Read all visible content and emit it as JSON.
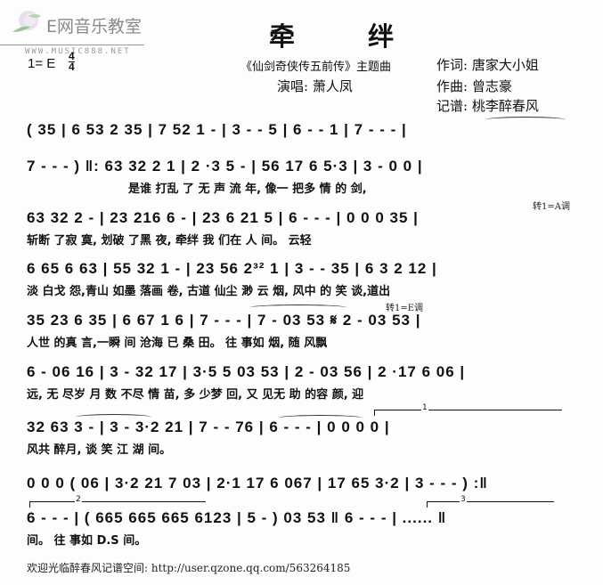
{
  "header": {
    "logo_text": "E网音乐教室",
    "logo_url_text": "WWW.MUSIC888.NET",
    "key": "1= E",
    "time_signature": {
      "top": "4",
      "bottom": "4"
    },
    "title": "牵 绊",
    "subtitle": "《仙剑奇侠传五前传》主题曲",
    "singer": "演唱: 萧人凤",
    "lyricist": "作词: 唐家大小姐",
    "composer": "作曲: 曾志豪",
    "transcriber": "记谱: 桃李醉春风"
  },
  "score": {
    "lines": [
      {
        "notes": "( 35 | 6 53 2 35 | 7 52 1 - | 3 - - 5 | 6 - - 1 | 7 - - - |",
        "lyrics": ""
      },
      {
        "notes": "7 - - - ) ‖: 63 32 2 1 | 2 ·3 5 - | 56 17 6 5·3 | 3 - 0 0 |",
        "lyrics": "是谁 打乱 了 无 声 流 年, 像一 把多 情 的 剑,"
      },
      {
        "notes": "63 32 2 - | 23 216 6 - | 23 6 21 5 | 6 - - - | 0 0 0 35 |",
        "lyrics": "斩断 了寂 寞, 划破 了黑 夜, 牵绊 我 们在 人 间。 云轻",
        "annotation": "转1=A调"
      },
      {
        "notes": "6 65 6 63 | 55 32 1 - | 23 56 2³² 1 | 3 - - 35 | 6 3 2 12 |",
        "lyrics": "淡 白戈 怨,青山 如墨 落画 卷, 古道 仙尘 渺 云 烟, 风中 的 笑 谈,道出"
      },
      {
        "notes": "35 23 6 35 | 6 67 1 6 | 7 - - - | 7 - 03 53 𝄋 2 - 03 53 |",
        "lyrics": "人世 的真 言,一瞬 间 沧海 已 桑 田。 往 事如 烟, 随 风飘",
        "annotation": "转1=E调"
      },
      {
        "notes": "6 - 06 16 | 3 - 32 17 | 3·5 5 03 53 | 2 - 03 56 | 2 ·17 6 06 |",
        "lyrics": "远, 无 尽岁 月 数 不尽 情 苗, 多 少梦 回, 又 见无 助 的容 颜, 迎"
      },
      {
        "notes": "32 63 3 - | 3 - 3·2 21 | 7 - - 76 | 6 - - - | 0 0 0 0 |",
        "lyrics": "风共 醉月, 谈 笑 江 湖 间。",
        "ending": "1"
      },
      {
        "notes": "0 0 0 ( 06 | 3·2 21 7 03 | 2·1 17 6 067 | 17 65 3·2 | 3 - - - ) :‖",
        "lyrics": ""
      },
      {
        "notes": "6 - - - | ( 665 665 665 6123 | 5 - ) 03 53 ‖ 6 - - - | ...... ‖",
        "lyrics": "间。 往 事如 D.S 间。",
        "ending_2": "2",
        "ending_3": "3"
      }
    ]
  },
  "footer": {
    "text": "欢迎光临醉春风记谱空间: http://user.qzone.qq.com/563264185"
  }
}
